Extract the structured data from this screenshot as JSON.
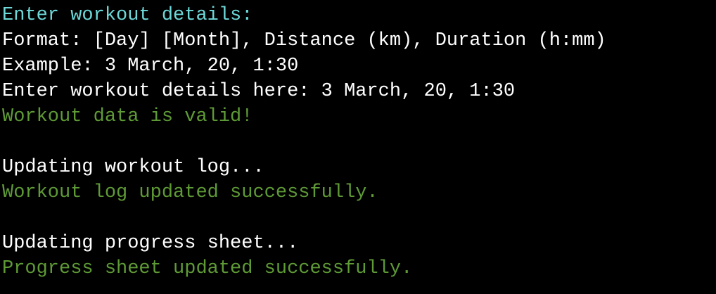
{
  "terminal": {
    "colors": {
      "background": "#000000",
      "prompt": "#6ed8d8",
      "text": "#ffffff",
      "success": "#5e9a36"
    },
    "lines": [
      {
        "text": "Enter workout details:",
        "color": "cyan"
      },
      {
        "text": "Format: [Day] [Month], Distance (km), Duration (h:mm)",
        "color": "white"
      },
      {
        "text": "Example: 3 March, 20, 1:30",
        "color": "white"
      },
      {
        "text": "Enter workout details here: 3 March, 20, 1:30",
        "color": "white"
      },
      {
        "text": "Workout data is valid!",
        "color": "green"
      },
      {
        "text": "",
        "color": "white"
      },
      {
        "text": "Updating workout log...",
        "color": "white"
      },
      {
        "text": "Workout log updated successfully.",
        "color": "green"
      },
      {
        "text": "",
        "color": "white"
      },
      {
        "text": "Updating progress sheet...",
        "color": "white"
      },
      {
        "text": "Progress sheet updated successfully.",
        "color": "green"
      }
    ]
  }
}
